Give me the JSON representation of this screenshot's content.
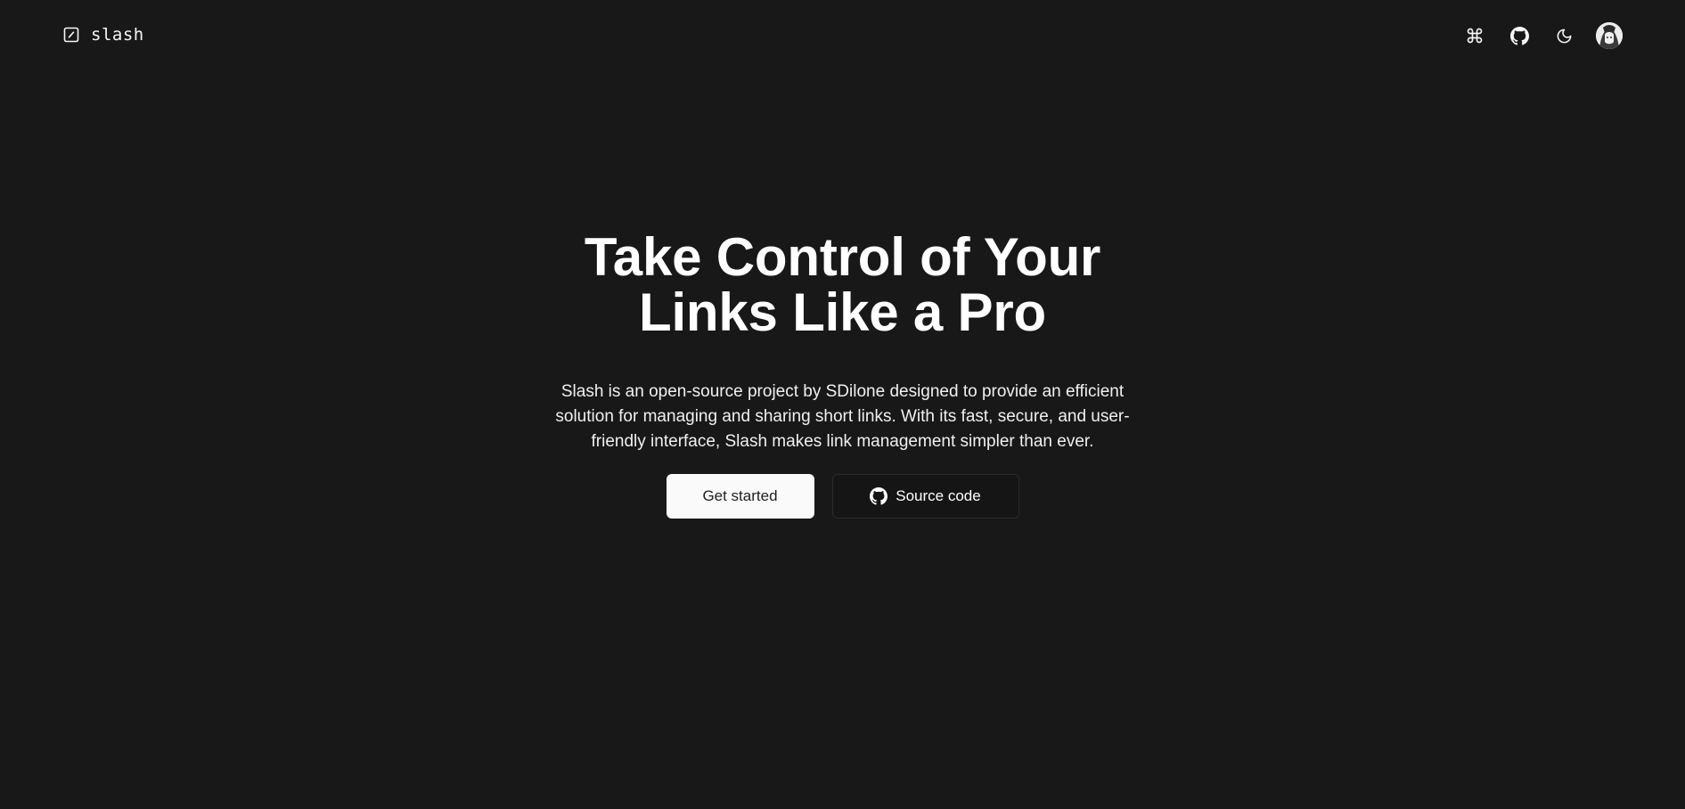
{
  "header": {
    "logo_text": "slash",
    "icons": {
      "logo": "slash-square-icon",
      "command": "command-icon",
      "github": "github-icon",
      "theme": "moon-icon",
      "avatar": "avatar"
    }
  },
  "hero": {
    "title": "Take Control of Your Links Like a Pro",
    "description": "Slash is an open-source project by SDilone designed to provide an efficient solution for managing and sharing short links. With its fast, secure, and user-friendly interface, Slash makes link management simpler than ever.",
    "primary_button": "Get started",
    "secondary_button": "Source code"
  },
  "colors": {
    "background": "#181818",
    "text": "#f5f5f5",
    "primary_button_bg": "#fafafa",
    "secondary_button_border": "#2b2b2b"
  }
}
